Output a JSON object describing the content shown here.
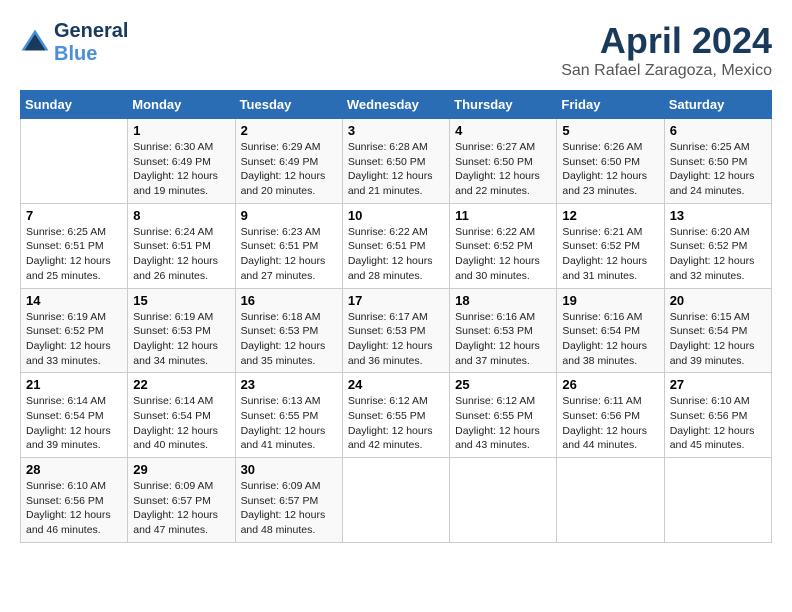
{
  "header": {
    "logo_line1": "General",
    "logo_line2": "Blue",
    "month": "April 2024",
    "location": "San Rafael Zaragoza, Mexico"
  },
  "columns": [
    "Sunday",
    "Monday",
    "Tuesday",
    "Wednesday",
    "Thursday",
    "Friday",
    "Saturday"
  ],
  "weeks": [
    [
      {
        "day": "",
        "info": ""
      },
      {
        "day": "1",
        "info": "Sunrise: 6:30 AM\nSunset: 6:49 PM\nDaylight: 12 hours\nand 19 minutes."
      },
      {
        "day": "2",
        "info": "Sunrise: 6:29 AM\nSunset: 6:49 PM\nDaylight: 12 hours\nand 20 minutes."
      },
      {
        "day": "3",
        "info": "Sunrise: 6:28 AM\nSunset: 6:50 PM\nDaylight: 12 hours\nand 21 minutes."
      },
      {
        "day": "4",
        "info": "Sunrise: 6:27 AM\nSunset: 6:50 PM\nDaylight: 12 hours\nand 22 minutes."
      },
      {
        "day": "5",
        "info": "Sunrise: 6:26 AM\nSunset: 6:50 PM\nDaylight: 12 hours\nand 23 minutes."
      },
      {
        "day": "6",
        "info": "Sunrise: 6:25 AM\nSunset: 6:50 PM\nDaylight: 12 hours\nand 24 minutes."
      }
    ],
    [
      {
        "day": "7",
        "info": "Sunrise: 6:25 AM\nSunset: 6:51 PM\nDaylight: 12 hours\nand 25 minutes."
      },
      {
        "day": "8",
        "info": "Sunrise: 6:24 AM\nSunset: 6:51 PM\nDaylight: 12 hours\nand 26 minutes."
      },
      {
        "day": "9",
        "info": "Sunrise: 6:23 AM\nSunset: 6:51 PM\nDaylight: 12 hours\nand 27 minutes."
      },
      {
        "day": "10",
        "info": "Sunrise: 6:22 AM\nSunset: 6:51 PM\nDaylight: 12 hours\nand 28 minutes."
      },
      {
        "day": "11",
        "info": "Sunrise: 6:22 AM\nSunset: 6:52 PM\nDaylight: 12 hours\nand 30 minutes."
      },
      {
        "day": "12",
        "info": "Sunrise: 6:21 AM\nSunset: 6:52 PM\nDaylight: 12 hours\nand 31 minutes."
      },
      {
        "day": "13",
        "info": "Sunrise: 6:20 AM\nSunset: 6:52 PM\nDaylight: 12 hours\nand 32 minutes."
      }
    ],
    [
      {
        "day": "14",
        "info": "Sunrise: 6:19 AM\nSunset: 6:52 PM\nDaylight: 12 hours\nand 33 minutes."
      },
      {
        "day": "15",
        "info": "Sunrise: 6:19 AM\nSunset: 6:53 PM\nDaylight: 12 hours\nand 34 minutes."
      },
      {
        "day": "16",
        "info": "Sunrise: 6:18 AM\nSunset: 6:53 PM\nDaylight: 12 hours\nand 35 minutes."
      },
      {
        "day": "17",
        "info": "Sunrise: 6:17 AM\nSunset: 6:53 PM\nDaylight: 12 hours\nand 36 minutes."
      },
      {
        "day": "18",
        "info": "Sunrise: 6:16 AM\nSunset: 6:53 PM\nDaylight: 12 hours\nand 37 minutes."
      },
      {
        "day": "19",
        "info": "Sunrise: 6:16 AM\nSunset: 6:54 PM\nDaylight: 12 hours\nand 38 minutes."
      },
      {
        "day": "20",
        "info": "Sunrise: 6:15 AM\nSunset: 6:54 PM\nDaylight: 12 hours\nand 39 minutes."
      }
    ],
    [
      {
        "day": "21",
        "info": "Sunrise: 6:14 AM\nSunset: 6:54 PM\nDaylight: 12 hours\nand 39 minutes."
      },
      {
        "day": "22",
        "info": "Sunrise: 6:14 AM\nSunset: 6:54 PM\nDaylight: 12 hours\nand 40 minutes."
      },
      {
        "day": "23",
        "info": "Sunrise: 6:13 AM\nSunset: 6:55 PM\nDaylight: 12 hours\nand 41 minutes."
      },
      {
        "day": "24",
        "info": "Sunrise: 6:12 AM\nSunset: 6:55 PM\nDaylight: 12 hours\nand 42 minutes."
      },
      {
        "day": "25",
        "info": "Sunrise: 6:12 AM\nSunset: 6:55 PM\nDaylight: 12 hours\nand 43 minutes."
      },
      {
        "day": "26",
        "info": "Sunrise: 6:11 AM\nSunset: 6:56 PM\nDaylight: 12 hours\nand 44 minutes."
      },
      {
        "day": "27",
        "info": "Sunrise: 6:10 AM\nSunset: 6:56 PM\nDaylight: 12 hours\nand 45 minutes."
      }
    ],
    [
      {
        "day": "28",
        "info": "Sunrise: 6:10 AM\nSunset: 6:56 PM\nDaylight: 12 hours\nand 46 minutes."
      },
      {
        "day": "29",
        "info": "Sunrise: 6:09 AM\nSunset: 6:57 PM\nDaylight: 12 hours\nand 47 minutes."
      },
      {
        "day": "30",
        "info": "Sunrise: 6:09 AM\nSunset: 6:57 PM\nDaylight: 12 hours\nand 48 minutes."
      },
      {
        "day": "",
        "info": ""
      },
      {
        "day": "",
        "info": ""
      },
      {
        "day": "",
        "info": ""
      },
      {
        "day": "",
        "info": ""
      }
    ]
  ]
}
